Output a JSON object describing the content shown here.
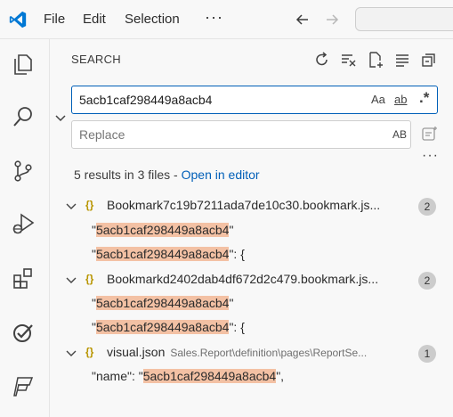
{
  "menu": {
    "file": "File",
    "edit": "Edit",
    "selection": "Selection",
    "more": "···"
  },
  "colors": {
    "accent": "#005fb8",
    "match_highlight": "#f3c1a4",
    "json_icon": "#b89500",
    "logo": "#0078d4"
  },
  "activity_icons": [
    "explorer-icon",
    "search-icon",
    "source-control-icon",
    "run-debug-icon",
    "extensions-icon",
    "testing-icon",
    "fabric-icon"
  ],
  "search_panel": {
    "title": "SEARCH",
    "search_value": "5acb1caf298449a8acb4",
    "match_case": "Aa",
    "match_word": "ab",
    "regex": ".*",
    "replace_placeholder": "Replace",
    "preserve_case": "AB",
    "more": "···",
    "summary": "5 results in 3 files - ",
    "open_in_editor": "Open in editor"
  },
  "results": [
    {
      "file": "Bookmark7c19b7211ada7de10c30.bookmark.js...",
      "path": "",
      "count": "2",
      "matches": [
        {
          "before": "\"",
          "match": "5acb1caf298449a8acb4",
          "after": "\""
        },
        {
          "before": "\"",
          "match": "5acb1caf298449a8acb4",
          "after": "\": {"
        }
      ]
    },
    {
      "file": "Bookmarkd2402dab4df672d2c479.bookmark.js...",
      "path": "",
      "count": "2",
      "matches": [
        {
          "before": "\"",
          "match": "5acb1caf298449a8acb4",
          "after": "\""
        },
        {
          "before": "\"",
          "match": "5acb1caf298449a8acb4",
          "after": "\": {"
        }
      ]
    },
    {
      "file": "visual.json",
      "path": "Sales.Report\\definition\\pages\\ReportSe...",
      "count": "1",
      "matches": [
        {
          "before": "\"name\": \"",
          "match": "5acb1caf298449a8acb4",
          "after": "\","
        }
      ]
    }
  ]
}
